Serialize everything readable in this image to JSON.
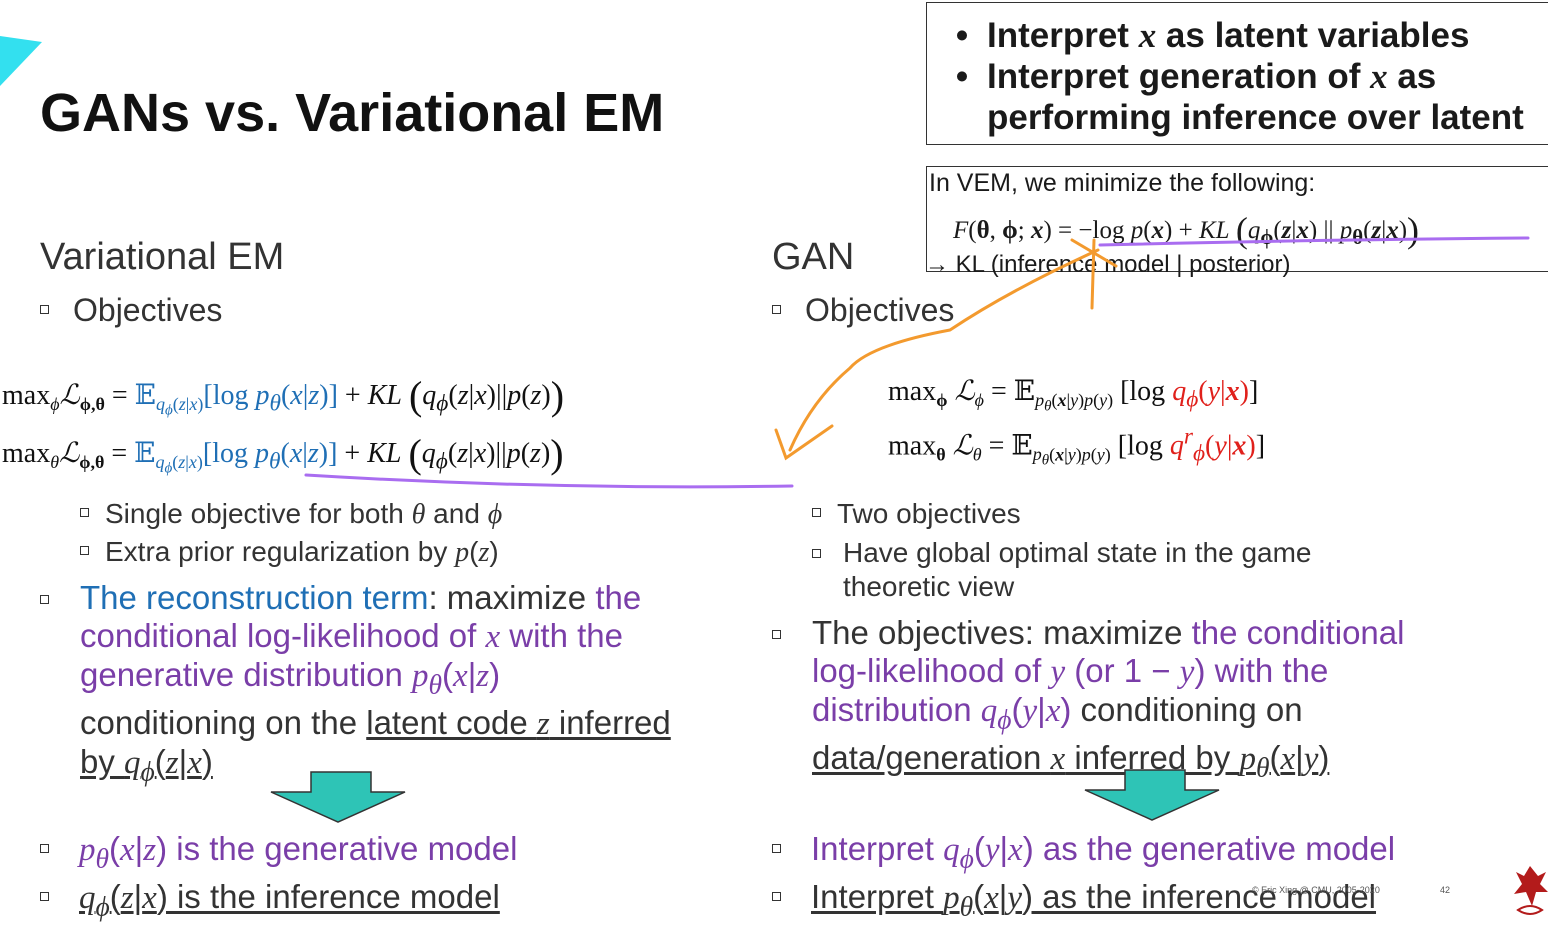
{
  "title": "GANs vs. Variational EM",
  "top_box": {
    "bullets": [
      {
        "pre": "Interpret ",
        "var": "x",
        "post": " as latent variables"
      },
      {
        "pre": "Interpret generation of ",
        "var": "x",
        "post": " as"
      },
      {
        "pre": "",
        "var": "",
        "post": "performing inference over latent"
      }
    ]
  },
  "vem_box": {
    "line1": "In VEM, we minimize the following:",
    "formula": "F(θ, ϕ; x) = −log p(x) + KL (q_ϕ(z|x) || p_θ(z|x))",
    "line3": "→ KL (inference model | posterior)"
  },
  "left": {
    "heading": "Variational EM",
    "objectives": "Objectives",
    "eq1": "max_ϕ ℒ_ϕ,θ = E_qϕ(z|x)[log p_θ(x|z)] + KL (q_ϕ(z|x)||p(z))",
    "eq2": "max_θ ℒ_ϕ,θ = E_qϕ(z|x)[log p_θ(x|z)] + KL (q_ϕ(z|x)||p(z))",
    "sub1": "Single objective for both θ and ϕ",
    "sub2": "Extra prior regularization by p(z)",
    "recon_blue": "The reconstruction term",
    "recon_rest": ": maximize ",
    "recon_purple": "the conditional log-likelihood of x with the generative distribution p_θ(x|z)",
    "recon_tail1": "conditioning on the ",
    "recon_under": "latent code z inferred by q_ϕ(z|x)",
    "bottom1": "p_θ(x|z) is the generative model",
    "bottom2": "q_ϕ(z|x) is the inference model"
  },
  "right": {
    "heading": "GAN",
    "objectives": "Objectives",
    "eq1": "max_ϕ ℒ_ϕ = E_pθ(x|y)p(y) [log q_ϕ(y|x)]",
    "eq2": "max_θ ℒ_θ = E_pθ(x|y)p(y) [log q^r_ϕ(y|x)]",
    "sub1": "Two objectives",
    "sub2": "Have global optimal state in the game theoretic view",
    "obj_pre": "The objectives: maximize ",
    "obj_purple": "the conditional log-likelihood of y (or 1 − y) with the distribution q_ϕ(y|x)",
    "obj_tail": " conditioning on ",
    "obj_under": "data/generation x inferred by p_θ(x|y)",
    "bottom1": "Interpret q_ϕ(y|x) as the generative model",
    "bottom2": "Interpret p_θ(x|y) as the inference model"
  },
  "footer": {
    "copyright": "© Eric Xing @ CMU, 2005-2020",
    "page": "42"
  },
  "colors": {
    "purple": "#7a3ea8",
    "blue": "#1f6fb5",
    "red": "#e0201b",
    "arrow_teal": "#2ec4b6",
    "annotation_orange": "#f39a2e",
    "annotation_violet": "#a96df0"
  }
}
